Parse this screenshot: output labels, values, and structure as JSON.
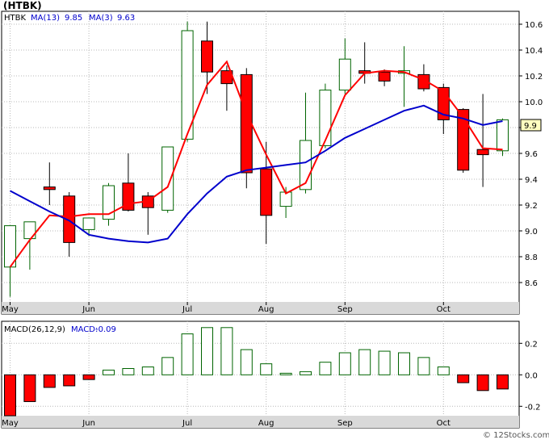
{
  "title": "(HTBK)",
  "watermark": "© 12Stocks.com",
  "chart_data": [
    {
      "type": "candlestick",
      "ticker": "HTBK",
      "legend": {
        "ticker": "HTBK",
        "ma13_label": "MA(13)",
        "ma13_value": "9.85",
        "ma3_label": "MA(3)",
        "ma3_value": "9.63"
      },
      "last_price_label": "9.9",
      "ylim": [
        8.45,
        10.7
      ],
      "y_ticks": [
        "10.6",
        "10.4",
        "10.2",
        "10.0",
        "9.8",
        "9.6",
        "9.4",
        "9.2",
        "9.0",
        "8.8",
        "8.6"
      ],
      "x_months": [
        {
          "label": "May",
          "week": 1
        },
        {
          "label": "Jun",
          "week": 5
        },
        {
          "label": "Jul",
          "week": 10
        },
        {
          "label": "Aug",
          "week": 14
        },
        {
          "label": "Sep",
          "week": 18
        },
        {
          "label": "Oct",
          "week": 23
        }
      ],
      "candles": [
        {
          "open": 8.72,
          "high": 9.04,
          "low": 8.49,
          "close": 9.04
        },
        {
          "open": 8.94,
          "high": 9.07,
          "low": 8.7,
          "close": 9.07
        },
        {
          "open": 9.34,
          "high": 9.53,
          "low": 9.2,
          "close": 9.32
        },
        {
          "open": 9.27,
          "high": 9.3,
          "low": 8.8,
          "close": 8.91
        },
        {
          "open": 9.01,
          "high": 9.1,
          "low": 8.96,
          "close": 9.1
        },
        {
          "open": 9.09,
          "high": 9.37,
          "low": 9.04,
          "close": 9.35
        },
        {
          "open": 9.37,
          "high": 9.6,
          "low": 9.15,
          "close": 9.16
        },
        {
          "open": 9.27,
          "high": 9.3,
          "low": 8.97,
          "close": 9.18
        },
        {
          "open": 9.16,
          "high": 9.65,
          "low": 9.14,
          "close": 9.65
        },
        {
          "open": 9.71,
          "high": 10.62,
          "low": 9.69,
          "close": 10.55
        },
        {
          "open": 10.47,
          "high": 10.62,
          "low": 10.06,
          "close": 10.23
        },
        {
          "open": 10.24,
          "high": 10.28,
          "low": 9.93,
          "close": 10.14
        },
        {
          "open": 10.21,
          "high": 10.26,
          "low": 9.33,
          "close": 9.45
        },
        {
          "open": 9.48,
          "high": 9.69,
          "low": 8.9,
          "close": 9.12
        },
        {
          "open": 9.19,
          "high": 9.34,
          "low": 9.1,
          "close": 9.3
        },
        {
          "open": 9.32,
          "high": 10.07,
          "low": 9.29,
          "close": 9.7
        },
        {
          "open": 9.66,
          "high": 10.14,
          "low": 9.64,
          "close": 10.09
        },
        {
          "open": 10.09,
          "high": 10.49,
          "low": 10.06,
          "close": 10.33
        },
        {
          "open": 10.24,
          "high": 10.46,
          "low": 10.14,
          "close": 10.22
        },
        {
          "open": 10.23,
          "high": 10.25,
          "low": 10.12,
          "close": 10.16
        },
        {
          "open": 10.22,
          "high": 10.43,
          "low": 9.96,
          "close": 10.24
        },
        {
          "open": 10.21,
          "high": 10.29,
          "low": 10.08,
          "close": 10.1
        },
        {
          "open": 10.11,
          "high": 10.14,
          "low": 9.75,
          "close": 9.86
        },
        {
          "open": 9.94,
          "high": 9.95,
          "low": 9.45,
          "close": 9.47
        },
        {
          "open": 9.63,
          "high": 10.06,
          "low": 9.34,
          "close": 9.59
        },
        {
          "open": 9.62,
          "high": 9.87,
          "low": 9.58,
          "close": 9.86
        }
      ],
      "ma13": [
        {
          "week": 1,
          "value": 8.72
        },
        {
          "week": 2,
          "value": 8.93
        },
        {
          "week": 3,
          "value": 9.12
        },
        {
          "week": 4,
          "value": 9.11
        },
        {
          "week": 5,
          "value": 9.13
        },
        {
          "week": 6,
          "value": 9.13
        },
        {
          "week": 7,
          "value": 9.21
        },
        {
          "week": 8,
          "value": 9.23
        },
        {
          "week": 9,
          "value": 9.34
        },
        {
          "week": 10,
          "value": 9.75
        },
        {
          "week": 11,
          "value": 10.13
        },
        {
          "week": 12,
          "value": 10.31
        },
        {
          "week": 13,
          "value": 9.91
        },
        {
          "week": 14,
          "value": 9.59
        },
        {
          "week": 15,
          "value": 9.29
        },
        {
          "week": 16,
          "value": 9.37
        },
        {
          "week": 17,
          "value": 9.7
        },
        {
          "week": 18,
          "value": 10.05
        },
        {
          "week": 19,
          "value": 10.22
        },
        {
          "week": 20,
          "value": 10.24
        },
        {
          "week": 21,
          "value": 10.23
        },
        {
          "week": 22,
          "value": 10.17
        },
        {
          "week": 23,
          "value": 10.08
        },
        {
          "week": 24,
          "value": 9.88
        },
        {
          "week": 25,
          "value": 9.64
        },
        {
          "week": 26,
          "value": 9.63
        }
      ],
      "ma3": [
        {
          "week": 1,
          "value": 9.31
        },
        {
          "week": 2,
          "value": 9.23
        },
        {
          "week": 3,
          "value": 9.15
        },
        {
          "week": 4,
          "value": 9.08
        },
        {
          "week": 5,
          "value": 8.97
        },
        {
          "week": 6,
          "value": 8.94
        },
        {
          "week": 7,
          "value": 8.92
        },
        {
          "week": 8,
          "value": 8.91
        },
        {
          "week": 9,
          "value": 8.94
        },
        {
          "week": 10,
          "value": 9.13
        },
        {
          "week": 11,
          "value": 9.29
        },
        {
          "week": 12,
          "value": 9.42
        },
        {
          "week": 13,
          "value": 9.47
        },
        {
          "week": 14,
          "value": 9.49
        },
        {
          "week": 15,
          "value": 9.51
        },
        {
          "week": 16,
          "value": 9.53
        },
        {
          "week": 17,
          "value": 9.62
        },
        {
          "week": 18,
          "value": 9.72
        },
        {
          "week": 19,
          "value": 9.79
        },
        {
          "week": 20,
          "value": 9.86
        },
        {
          "week": 21,
          "value": 9.93
        },
        {
          "week": 22,
          "value": 9.97
        },
        {
          "week": 23,
          "value": 9.9
        },
        {
          "week": 24,
          "value": 9.87
        },
        {
          "week": 25,
          "value": 9.82
        },
        {
          "week": 26,
          "value": 9.85
        }
      ]
    },
    {
      "type": "bar",
      "legend": {
        "label": "MACD(26,12,9)",
        "macd_label": "MACD:",
        "macd_value": "-0.09"
      },
      "ylim": [
        -0.26,
        0.34
      ],
      "y_ticks": [
        "0.2",
        "0.0",
        "-0.2"
      ],
      "x_months": [
        {
          "label": "May",
          "week": 1
        },
        {
          "label": "Jun",
          "week": 5
        },
        {
          "label": "Jul",
          "week": 10
        },
        {
          "label": "Aug",
          "week": 14
        },
        {
          "label": "Sep",
          "week": 18
        },
        {
          "label": "Oct",
          "week": 23
        }
      ],
      "values": [
        -0.26,
        -0.17,
        -0.08,
        -0.07,
        -0.03,
        0.03,
        0.04,
        0.05,
        0.11,
        0.26,
        0.3,
        0.3,
        0.16,
        0.07,
        0.01,
        0.02,
        0.08,
        0.14,
        0.16,
        0.15,
        0.14,
        0.11,
        0.05,
        -0.05,
        -0.1,
        -0.09
      ]
    }
  ],
  "colors": {
    "up_fill": "#ffffff",
    "up_stroke": "#006400",
    "down_fill": "#ff0000",
    "down_stroke": "#000000",
    "ma13": "#ff0000",
    "ma3": "#0000cc",
    "grid": "#b8b8b8",
    "axis_band": "#d9d9d9",
    "macd_neg": "#ff0000",
    "macd_pos": "#ffffff",
    "macd_stroke": "#006400",
    "last_price_bg": "#fffec0"
  }
}
